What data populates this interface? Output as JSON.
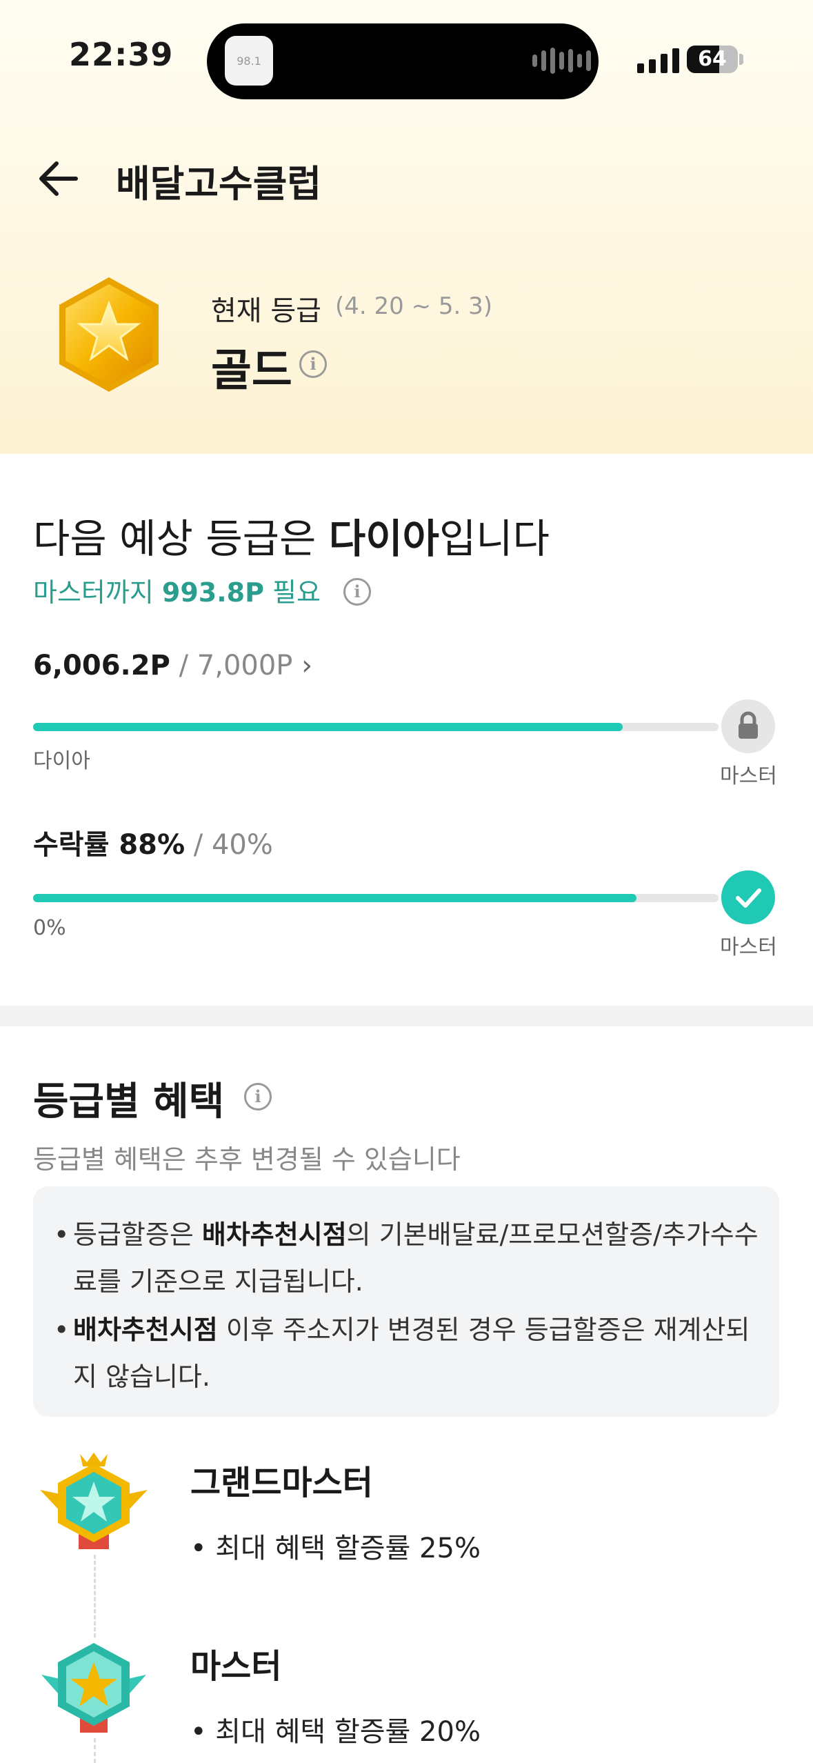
{
  "status_bar": {
    "time": "22:39",
    "island_app_text": "98.1",
    "battery": "64"
  },
  "header": {
    "title": "배달고수클럽"
  },
  "current": {
    "label": "현재 등급",
    "period": "(4. 20 ~ 5. 3)",
    "grade": "골드",
    "info_icon": "i"
  },
  "next": {
    "title_prefix": "다음 예상 등급은 ",
    "grade": "다이아",
    "title_suffix": "입니다",
    "need_prefix": "마스터까지 ",
    "need_points": "993.8P",
    "need_suffix": " 필요"
  },
  "points": {
    "current": "6,006.2P",
    "target": " / 7,000P",
    "chevron": "›",
    "progress": 0.86,
    "left_label": "다이아",
    "right_label": "마스터",
    "icon": "lock-icon"
  },
  "acceptance": {
    "label": "수락률 88%",
    "target": " / 40%",
    "progress": 0.88,
    "left_label": "0%",
    "right_label": "마스터",
    "icon": "check-icon"
  },
  "benefits": {
    "title": "등급별 혜택",
    "subtitle": "등급별 혜택은 추후 변경될 수 있습니다",
    "notice1_a": "등급할증은 ",
    "notice1_b": "배차추천시점",
    "notice1_c": "의 기본배달료/프로모션할증/추가수수료를 기준으로 지급됩니다.",
    "notice2_b": "배차추천시점",
    "notice2_c": " 이후 주소지가 변경된 경우 등급할증은 재계산되지 않습니다.",
    "tiers": [
      {
        "name": "그랜드마스터",
        "desc": "• 최대 혜택 할증률 25%"
      },
      {
        "name": "마스터",
        "desc": "• 최대 혜택 할증률 20%"
      }
    ]
  },
  "colors": {
    "accent": "#1fc9b4",
    "need_text": "#2a9d8f",
    "header_bg": "#fdf3d4"
  }
}
